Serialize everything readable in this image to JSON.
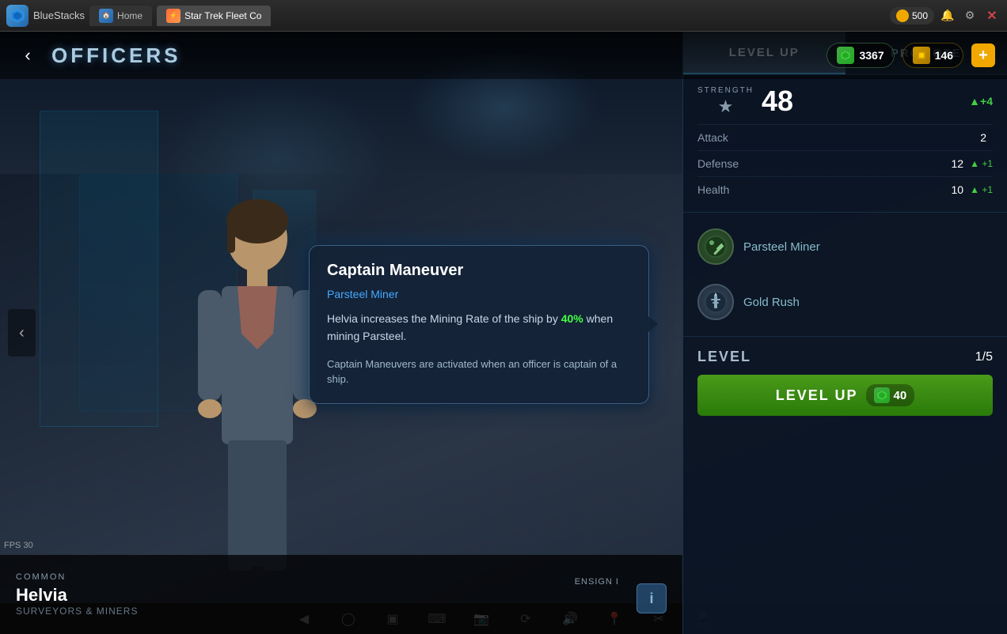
{
  "bluestacks": {
    "title": "BlueStacks",
    "coin_amount": "500",
    "tabs": [
      {
        "label": "Home",
        "type": "home"
      },
      {
        "label": "Star Trek Fleet Co",
        "type": "game",
        "active": true
      }
    ]
  },
  "game": {
    "page_title": "OFFICERS",
    "resources": {
      "green_amount": "3367",
      "gold_amount": "146"
    }
  },
  "right_panel": {
    "tabs": [
      {
        "label": "LEVEL UP",
        "active": true
      },
      {
        "label": "PROMOTE",
        "active": false
      }
    ],
    "strength": {
      "label": "STRENGTH",
      "value": "48",
      "change": "+4"
    },
    "stats": [
      {
        "name": "Attack",
        "value": "2",
        "change": null
      },
      {
        "name": "Defense",
        "value": "12",
        "change": "+1"
      },
      {
        "name": "Health",
        "value": "10",
        "change": "+1"
      }
    ],
    "abilities": [
      {
        "name": "Parsteel Miner",
        "type": "mining"
      },
      {
        "name": "Gold Rush",
        "type": "rush"
      }
    ],
    "level": {
      "label": "LEVEL",
      "current": "1",
      "max": "5",
      "display": "1/5"
    },
    "level_up_btn": {
      "label": "LEVEL UP",
      "cost": "40"
    }
  },
  "captain_popup": {
    "title": "Captain Maneuver",
    "subtitle": "Parsteel Miner",
    "body": "Helvia increases the Mining Rate of the ship by 40% when mining Parsteel.",
    "highlight": "40%",
    "note": "Captain Maneuvers are activated when an officer is captain of a ship."
  },
  "officer": {
    "rank": "COMMON",
    "rank_right": "ENSIGN I",
    "name": "Helvia",
    "type": "SURVEYORS & MINERS"
  },
  "fps": {
    "label": "FPS",
    "value": "30"
  }
}
